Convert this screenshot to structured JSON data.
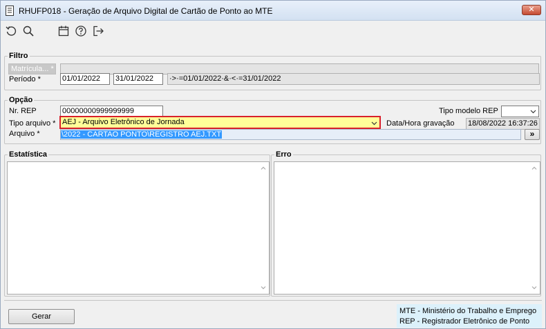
{
  "window": {
    "title": "RHUFP018 - Geração de Arquivo Digital de Cartão de Ponto ao MTE",
    "close_label": "✕"
  },
  "toolbar": {
    "icons": [
      "undo-icon",
      "search-icon",
      "calendar-icon",
      "help-icon",
      "exit-icon"
    ]
  },
  "filtro": {
    "legend": "Filtro",
    "matricula_label": "Matrícula... *",
    "matricula_value": "",
    "periodo_label": "Período *",
    "periodo_start": "01/01/2022",
    "periodo_end": "31/01/2022",
    "periodo_expr": "·>·=01/01/2022·&·<·=31/01/2022"
  },
  "opcao": {
    "legend": "Opção",
    "nr_rep_label": "Nr. REP",
    "nr_rep_value": "00000000999999999",
    "tipo_modelo_rep_label": "Tipo modelo REP",
    "tipo_modelo_rep_value": "",
    "tipo_arquivo_label": "Tipo arquivo *",
    "tipo_arquivo_value": "AEJ - Arquivo Eletrônico de Jornada",
    "data_hora_label": "Data/Hora gravação",
    "data_hora_value": "18/08/2022 16:37:26",
    "arquivo_label": "Arquivo *",
    "arquivo_value": "\\2022 - CARTAO PONTO\\REGISTRO AEJ.TXT",
    "browse_label": "»"
  },
  "estatistica": {
    "legend": "Estatística"
  },
  "erro": {
    "legend": "Erro"
  },
  "footer": {
    "gerar_label": "Gerar",
    "legend_line1": "MTE - Ministério do Trabalho e Emprego",
    "legend_line2": "REP - Registrador Eletrônico de Ponto"
  },
  "colors": {
    "highlight_border": "#d8202a",
    "highlight_fill": "#ffff99",
    "selection": "#3399ff",
    "legend_bg": "#dcf1fb"
  }
}
